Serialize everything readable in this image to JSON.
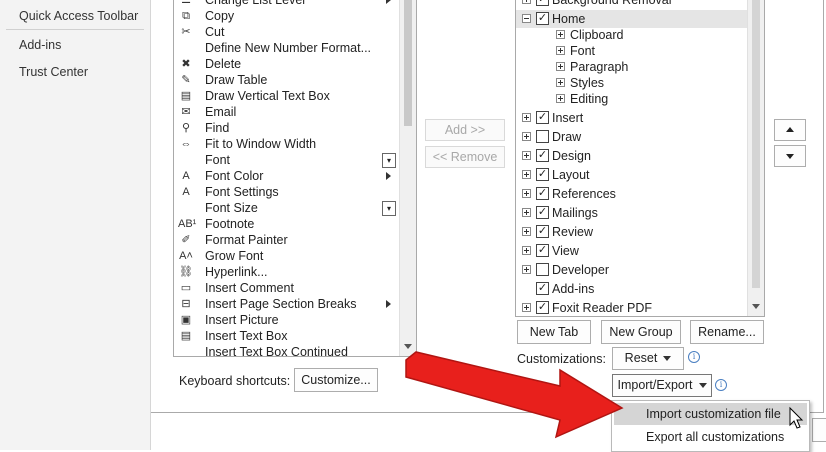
{
  "sidebar": {
    "items": [
      {
        "label": "Quick Access Toolbar"
      },
      {
        "label": "Add-ins"
      },
      {
        "label": "Trust Center"
      }
    ]
  },
  "commands": {
    "items": [
      {
        "icon": "bullet-list-icon",
        "glyph": "☰",
        "label": "Change List Level",
        "submenu": true
      },
      {
        "icon": "copy-icon",
        "glyph": "⧉",
        "label": "Copy"
      },
      {
        "icon": "scissors-icon",
        "glyph": "✂",
        "label": "Cut"
      },
      {
        "icon": "",
        "glyph": "",
        "label": "Define New Number Format..."
      },
      {
        "icon": "delete-icon",
        "glyph": "✖",
        "label": "Delete"
      },
      {
        "icon": "draw-table-icon",
        "glyph": "✎",
        "label": "Draw Table"
      },
      {
        "icon": "vertical-text-box-icon",
        "glyph": "▤",
        "label": "Draw Vertical Text Box"
      },
      {
        "icon": "email-icon",
        "glyph": "✉",
        "label": "Email"
      },
      {
        "icon": "find-icon",
        "glyph": "⚲",
        "label": "Find"
      },
      {
        "icon": "fit-window-icon",
        "glyph": "⇔",
        "label": "Fit to Window Width"
      },
      {
        "icon": "",
        "glyph": "",
        "label": "Font",
        "dropdown": true
      },
      {
        "icon": "font-color-icon",
        "glyph": "A",
        "label": "Font Color",
        "submenu": true
      },
      {
        "icon": "font-settings-icon",
        "glyph": "A",
        "label": "Font Settings"
      },
      {
        "icon": "",
        "glyph": "",
        "label": "Font Size",
        "dropdown": true
      },
      {
        "icon": "footnote-icon",
        "glyph": "AB¹",
        "label": "Footnote"
      },
      {
        "icon": "format-painter-icon",
        "glyph": "✐",
        "label": "Format Painter"
      },
      {
        "icon": "grow-font-icon",
        "glyph": "A˄",
        "label": "Grow Font"
      },
      {
        "icon": "hyperlink-icon",
        "glyph": "⛓",
        "label": "Hyperlink..."
      },
      {
        "icon": "insert-comment-icon",
        "glyph": "▭",
        "label": "Insert Comment"
      },
      {
        "icon": "section-break-icon",
        "glyph": "⊟",
        "label": "Insert Page  Section Breaks",
        "submenu": true
      },
      {
        "icon": "insert-picture-icon",
        "glyph": "▣",
        "label": "Insert Picture"
      },
      {
        "icon": "insert-text-box-icon",
        "glyph": "▤",
        "label": "Insert Text Box"
      },
      {
        "icon": "",
        "glyph": "",
        "label": "Insert Text Box Continued"
      }
    ]
  },
  "buttons": {
    "add": "Add >>",
    "remove": "<< Remove",
    "new_tab": "New Tab",
    "new_group": "New Group",
    "rename": "Rename...",
    "customize": "Customize...",
    "reset": "Reset",
    "import_export": "Import/Export"
  },
  "labels": {
    "keyboard_shortcuts": "Keyboard shortcuts:",
    "customizations": "Customizations:"
  },
  "tree": {
    "items": [
      {
        "label": "Background Removal",
        "level": 0,
        "expander": "plus",
        "checked": true
      },
      {
        "label": "Home",
        "level": 0,
        "expander": "minus",
        "checked": true,
        "selected": true
      },
      {
        "label": "Clipboard",
        "level": 1,
        "expander": "plus"
      },
      {
        "label": "Font",
        "level": 1,
        "expander": "plus"
      },
      {
        "label": "Paragraph",
        "level": 1,
        "expander": "plus"
      },
      {
        "label": "Styles",
        "level": 1,
        "expander": "plus"
      },
      {
        "label": "Editing",
        "level": 1,
        "expander": "plus"
      },
      {
        "label": "Insert",
        "level": 0,
        "expander": "plus",
        "checked": true
      },
      {
        "label": "Draw",
        "level": 0,
        "expander": "plus",
        "checked": false
      },
      {
        "label": "Design",
        "level": 0,
        "expander": "plus",
        "checked": true
      },
      {
        "label": "Layout",
        "level": 0,
        "expander": "plus",
        "checked": true
      },
      {
        "label": "References",
        "level": 0,
        "expander": "plus",
        "checked": true
      },
      {
        "label": "Mailings",
        "level": 0,
        "expander": "plus",
        "checked": true
      },
      {
        "label": "Review",
        "level": 0,
        "expander": "plus",
        "checked": true
      },
      {
        "label": "View",
        "level": 0,
        "expander": "plus",
        "checked": true
      },
      {
        "label": "Developer",
        "level": 0,
        "expander": "plus",
        "checked": false
      },
      {
        "label": "Add-ins",
        "level": 0,
        "expander": "none",
        "checked": true
      },
      {
        "label": "Foxit Reader PDF",
        "level": 0,
        "expander": "plus",
        "checked": true
      }
    ]
  },
  "menu": {
    "items": [
      {
        "label": "Import customization file",
        "highlighted": true
      },
      {
        "label": "Export all customizations",
        "highlighted": false
      }
    ]
  },
  "colors": {
    "arrow": "#e8201c",
    "info": "#4a7fc1",
    "selection": "#e5e5e5"
  }
}
